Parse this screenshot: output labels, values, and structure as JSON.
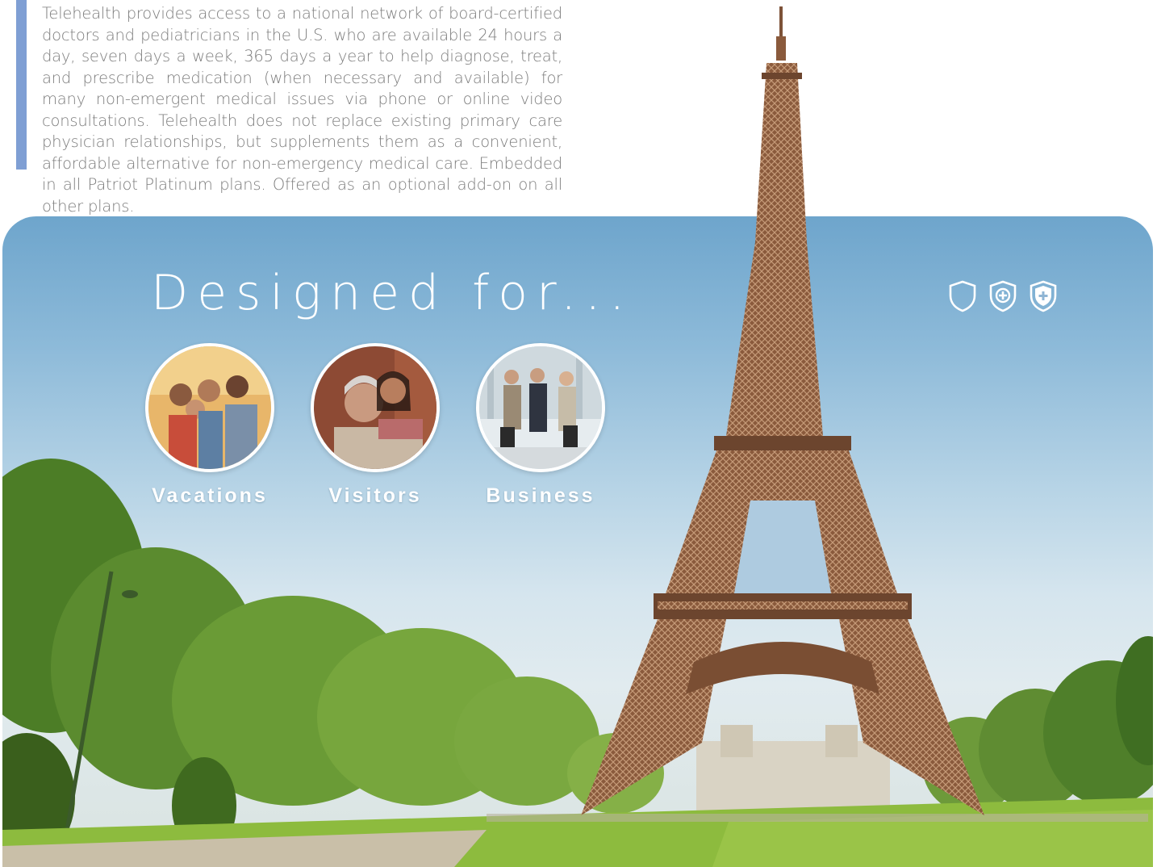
{
  "intro": {
    "text": "Telehealth provides access to a national network of board-certified doctors and pediatricians in the U.S. who are available 24 hours a day, seven days a week, 365 days a year to help diagnose, treat, and prescribe medication (when necessary and available) for many non-emergent medical issues via phone or online video consultations. Telehealth does not replace existing primary care physician relationships, but supplements them as a convenient, affordable alternative for non-emergency medical care. Embedded in all Patriot Platinum plans. Offered as an optional add-on on all other plans."
  },
  "hero": {
    "title": "Designed for...",
    "icons": [
      "shield-outline-icon",
      "shield-plus-icon",
      "shield-plus-filled-icon"
    ],
    "categories": [
      {
        "label": "Vacations",
        "image": "group-of-friends-photo"
      },
      {
        "label": "Visitors",
        "image": "grandmother-and-granddaughter-photo"
      },
      {
        "label": "Business",
        "image": "business-travelers-photo"
      }
    ]
  },
  "colors": {
    "accent_bar": "#7f9fd4",
    "body_text": "#7c7c7c",
    "sky_top": "#6ea5cc",
    "title_white": "#ffffff"
  }
}
